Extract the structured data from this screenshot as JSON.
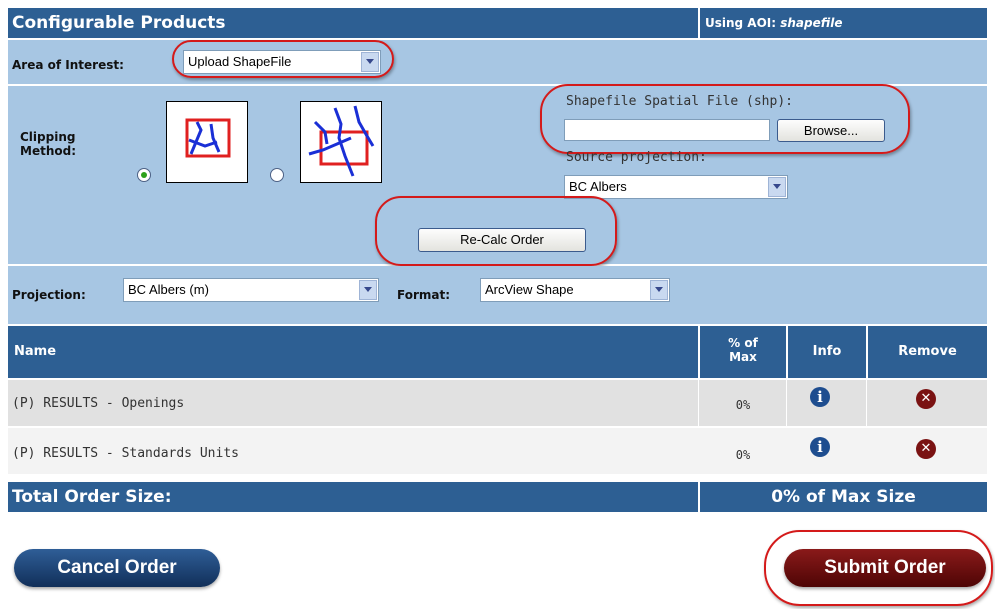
{
  "header": {
    "title": "Configurable Products",
    "aoi_prefix": "Using AOI:",
    "aoi_value": "shapefile"
  },
  "area_of_interest": {
    "label": "Area of Interest:",
    "selected": "Upload ShapeFile"
  },
  "clipping": {
    "label_line1": "Clipping",
    "label_line2": "Method:",
    "options": [
      {
        "selected": true
      },
      {
        "selected": false
      }
    ]
  },
  "shapefile": {
    "label": "Shapefile Spatial File (shp):",
    "file_value": "",
    "browse_label": "Browse...",
    "source_projection_label": "Source projection:",
    "source_projection_selected": "BC Albers"
  },
  "recalc_label": "Re-Calc Order",
  "projection": {
    "label": "Projection:",
    "selected": "BC Albers (m)"
  },
  "format": {
    "label": "Format:",
    "selected": "ArcView Shape"
  },
  "table": {
    "headers": {
      "name": "Name",
      "pct_line1": "% of",
      "pct_line2": "Max",
      "info": "Info",
      "remove": "Remove"
    },
    "rows": [
      {
        "name": "(P) RESULTS - Openings",
        "pct": "0%"
      },
      {
        "name": "(P) RESULTS - Standards Units",
        "pct": "0%"
      }
    ]
  },
  "total": {
    "label": "Total Order Size:",
    "value": "0% of Max Size"
  },
  "actions": {
    "cancel": "Cancel Order",
    "submit": "Submit Order"
  },
  "colors": {
    "header_blue": "#2d5f93",
    "panel_blue": "#a7c6e3",
    "highlight_red": "#d41a1a",
    "submit_red": "#6b0b0b"
  },
  "icons": [
    "info-icon",
    "remove-icon",
    "dropdown-arrow-icon",
    "clip-inside-icon",
    "clip-intersect-icon"
  ]
}
